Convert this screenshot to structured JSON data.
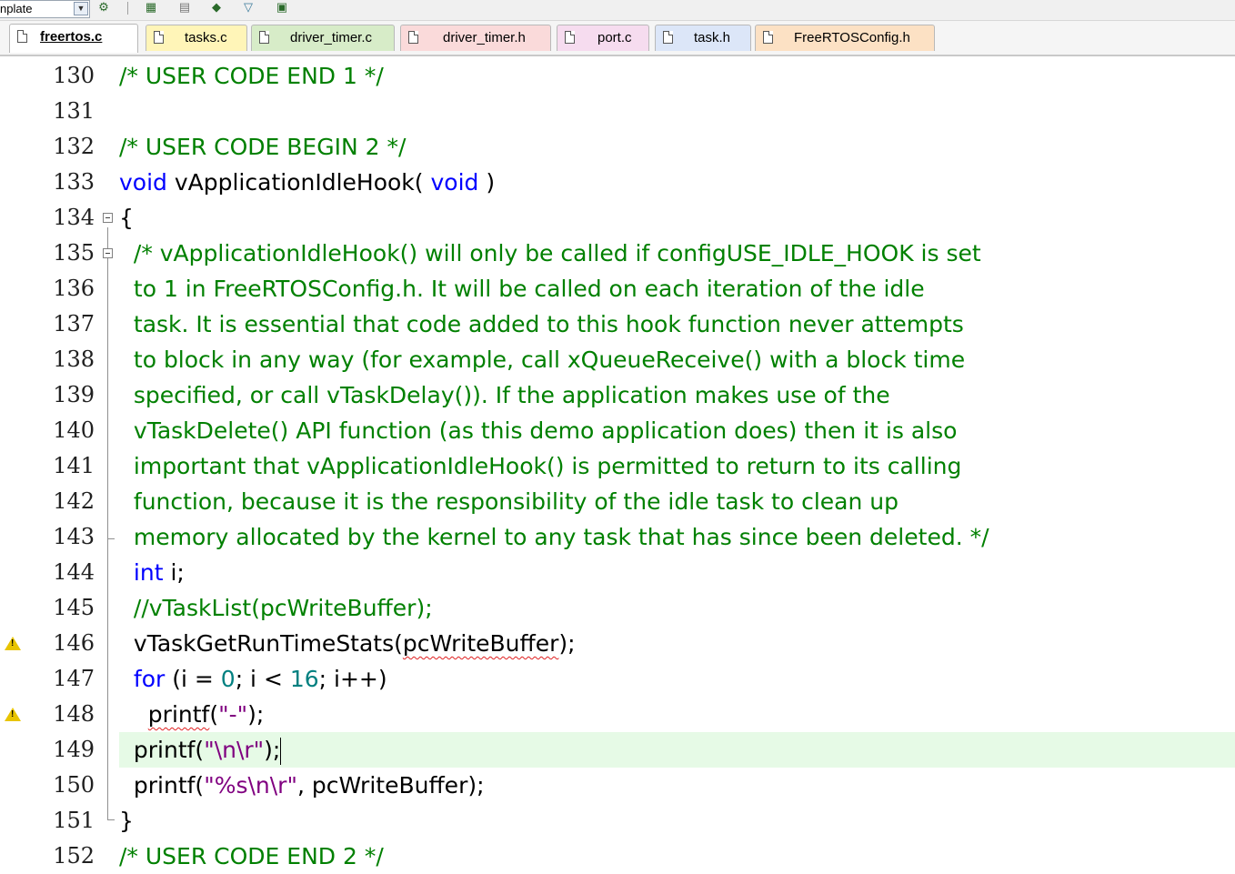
{
  "toolbar": {
    "target_combo": "nplate",
    "icons": [
      "target-options-icon",
      "load-icon",
      "build-icon",
      "rebuild-icon",
      "diamond-icon",
      "flash-icon"
    ]
  },
  "tabs": [
    {
      "label": "freertos.c",
      "active": true,
      "color": "#ffffff"
    },
    {
      "label": "tasks.c",
      "active": false,
      "color": "#fff5b8"
    },
    {
      "label": "driver_timer.c",
      "active": false,
      "color": "#d7ecc8"
    },
    {
      "label": "driver_timer.h",
      "active": false,
      "color": "#fadada"
    },
    {
      "label": "port.c",
      "active": false,
      "color": "#f6dcef"
    },
    {
      "label": "task.h",
      "active": false,
      "color": "#dce6f8"
    },
    {
      "label": "FreeRTOSConfig.h",
      "active": false,
      "color": "#fce1c4"
    }
  ],
  "editor": {
    "lines": [
      {
        "n": "130",
        "text": "/* USER CODE END 1 */"
      },
      {
        "n": "131",
        "text": ""
      },
      {
        "n": "132",
        "text": "/* USER CODE BEGIN 2 */"
      },
      {
        "n": "133",
        "kw1": "void",
        "mid": " vApplicationIdleHook( ",
        "kw2": "void",
        "end": " )"
      },
      {
        "n": "134",
        "text": "{"
      },
      {
        "n": "135",
        "text": "  /* vApplicationIdleHook() will only be called if configUSE_IDLE_HOOK is set"
      },
      {
        "n": "136",
        "text": "  to 1 in FreeRTOSConfig.h. It will be called on each iteration of the idle"
      },
      {
        "n": "137",
        "text": "  task. It is essential that code added to this hook function never attempts"
      },
      {
        "n": "138",
        "text": "  to block in any way (for example, call xQueueReceive() with a block time"
      },
      {
        "n": "139",
        "text": "  specified, or call vTaskDelay()). If the application makes use of the"
      },
      {
        "n": "140",
        "text": "  vTaskDelete() API function (as this demo application does) then it is also"
      },
      {
        "n": "141",
        "text": "  important that vApplicationIdleHook() is permitted to return to its calling"
      },
      {
        "n": "142",
        "text": "  function, because it is the responsibility of the idle task to clean up"
      },
      {
        "n": "143",
        "text": "  memory allocated by the kernel to any task that has since been deleted. */"
      },
      {
        "n": "144",
        "kw": "int",
        "rest": " i;"
      },
      {
        "n": "145",
        "text": "  //vTaskList(pcWriteBuffer);"
      },
      {
        "n": "146",
        "a": "  vTaskGetRunTimeStats(",
        "sq": "pcWriteBuffer",
        "b": ");"
      },
      {
        "n": "147",
        "kw": "for",
        "p1": " (i = ",
        "num1": "0",
        "p2": "; i < ",
        "num2": "16",
        "p3": "; i++)"
      },
      {
        "n": "148",
        "pre": "    ",
        "sq": "printf",
        "p1": "(",
        "str": "\"-\"",
        "p2": ");"
      },
      {
        "n": "149",
        "pre": "  printf(",
        "str": "\"\\n\\r\"",
        "post": ");"
      },
      {
        "n": "150",
        "pre": "  printf(",
        "str": "\"%s\\n\\r\"",
        "post": ", pcWriteBuffer);"
      },
      {
        "n": "151",
        "text": "}"
      },
      {
        "n": "152",
        "text": "/* USER CODE END 2 */"
      }
    ]
  }
}
